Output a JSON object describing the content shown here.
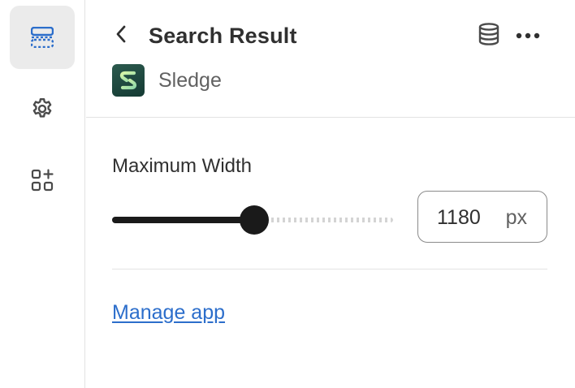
{
  "rail": {
    "items": [
      {
        "name": "sections",
        "icon": "layout-sections-icon",
        "active": true
      },
      {
        "name": "settings",
        "icon": "gear-icon",
        "active": false
      },
      {
        "name": "apps",
        "icon": "apps-add-icon",
        "active": false
      }
    ]
  },
  "header": {
    "title": "Search Result",
    "app_name": "Sledge"
  },
  "field": {
    "label": "Maximum Width",
    "value": "1180",
    "unit": "px",
    "slider_fraction": 0.506
  },
  "link": {
    "label": "Manage app"
  },
  "colors": {
    "accent_icon": "#2c6ecb",
    "link": "#2c6ecb",
    "slider": "#1a1a1a"
  }
}
